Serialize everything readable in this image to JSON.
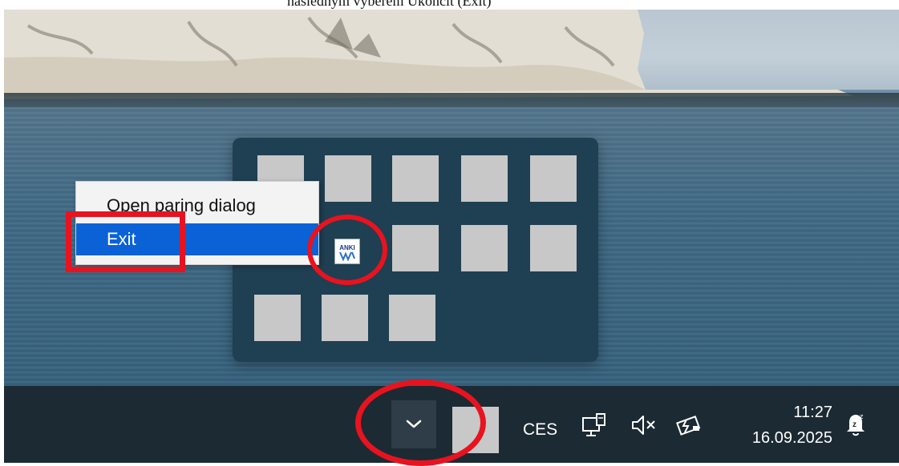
{
  "caption": {
    "text": "následným výběrem Ukončit (Exit)"
  },
  "context_menu": {
    "items": [
      {
        "label": "Open paring dialog",
        "selected": false
      },
      {
        "label": "Exit",
        "selected": true
      }
    ]
  },
  "tray_overflow": {
    "app_icon_label": "ANKI"
  },
  "taskbar": {
    "language": "CES",
    "time": "11:27",
    "date": "16.09.2025"
  },
  "colors": {
    "annotation_red": "#e8131f",
    "menu_selected": "#0a62d6",
    "taskbar_bg": "#1c2a33",
    "overflow_panel_bg": "#1f3f52"
  },
  "icons": [
    "chevron-up-icon",
    "network-icon",
    "volume-muted-icon",
    "battery-charging-icon",
    "notification-icon",
    "anki-icon"
  ]
}
